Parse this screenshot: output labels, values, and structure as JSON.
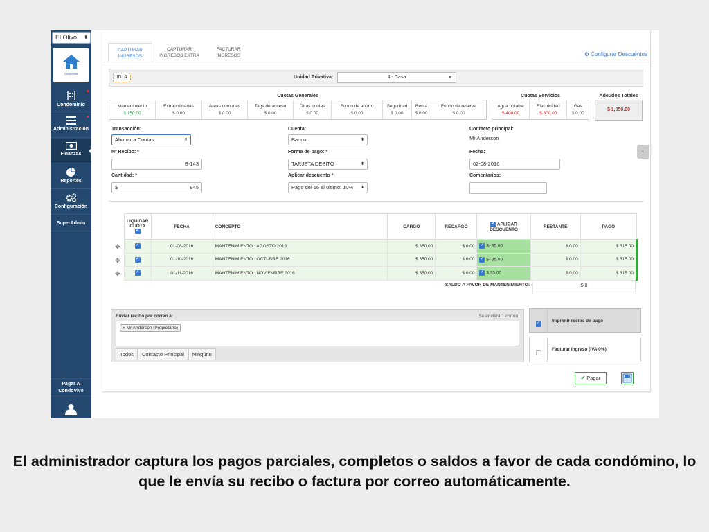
{
  "sidebar": {
    "condo_select": "El Olivo",
    "logo_text": "CondoVive",
    "items": [
      {
        "label": "Condominio",
        "icon": "building-icon"
      },
      {
        "label": "Administración",
        "icon": "list-icon"
      },
      {
        "label": "Finanzas",
        "icon": "money-icon"
      },
      {
        "label": "Reportes",
        "icon": "pie-chart-icon"
      },
      {
        "label": "Configuración",
        "icon": "gears-icon"
      },
      {
        "label": "SuperAdmin",
        "icon": ""
      }
    ],
    "pagar_a": "Pagar A",
    "pagar_a_sub": "CondoVive"
  },
  "tabs": [
    {
      "line1": "CAPTURAR",
      "line2": "INGRESOS"
    },
    {
      "line1": "CAPTURAR",
      "line2": "INGRESOS EXTRA"
    },
    {
      "line1": "FACTURAR",
      "line2": "INGRESOS"
    }
  ],
  "config_link": "Configurar Descuentos",
  "topbar": {
    "id": "ID: 4",
    "unidad_label": "Unidad Privativa:",
    "unidad_value": "4 - Casa"
  },
  "cuotas_generales": {
    "title": "Cuotas Generales",
    "items": [
      {
        "name": "Mantenimiento",
        "value": "$ 150.00"
      },
      {
        "name": "Extraordinarias",
        "value": "$ 0.00"
      },
      {
        "name": "Areas comunes",
        "value": "$ 0.00"
      },
      {
        "name": "Tags de acceso",
        "value": "$ 0.00"
      },
      {
        "name": "Otras cuotas",
        "value": "$ 0.00"
      },
      {
        "name": "Fondo de ahorro",
        "value": "$ 0.00"
      },
      {
        "name": "Seguridad",
        "value": "$ 0.00"
      },
      {
        "name": "Renta",
        "value": "$ 0.00"
      },
      {
        "name": "Fondo de reserva",
        "value": "$ 0.00"
      }
    ]
  },
  "cuotas_servicios": {
    "title": "Cuotas Servicios",
    "items": [
      {
        "name": "Agua potable",
        "value": "$ 400.00"
      },
      {
        "name": "Electricidad",
        "value": "$ 300.00"
      },
      {
        "name": "Gas",
        "value": "$ 0.00"
      }
    ]
  },
  "adeudos": {
    "title": "Adeudos Totales",
    "value": "$ 1,050.00"
  },
  "form": {
    "transaccion_label": "Transacción:",
    "transaccion_value": "Abonar a Cuotas",
    "recibo_label": "Nº Recibo: *",
    "recibo_value": "B-143",
    "cantidad_label": "Cantidad: *",
    "cantidad_prefix": "$",
    "cantidad_value": "945",
    "cuenta_label": "Cuenta:",
    "cuenta_value": "Banco",
    "forma_label": "Forma de pago: *",
    "forma_value": "TARJETA DEBITO",
    "descuento_label": "Aplicar descuento *",
    "descuento_value": "Pago del 16 al ultimo: 10%",
    "contacto_label": "Contacto principal:",
    "contacto_value": "Mr Anderson",
    "fecha_label": "Fecha:",
    "fecha_value": "02-08-2016",
    "comentarios_label": "Comentarios:",
    "comentarios_value": ""
  },
  "table": {
    "headers": {
      "liquidar": "LIQUIDAR CUOTA",
      "fecha": "FECHA",
      "concepto": "CONCEPTO",
      "cargo": "CARGO",
      "recargo": "RECARGO",
      "aplicar": "APLICAR DESCUENTO",
      "restante": "RESTANTE",
      "pago": "PAGO"
    },
    "rows": [
      {
        "fecha": "01-08-2016",
        "concepto": "MANTENIMIENTO : AGOSTO 2016",
        "cargo": "$ 350.00",
        "recargo": "$ 0.00",
        "descuento": "$- 35.00",
        "restante": "$ 0.00",
        "pago": "$ 315.00"
      },
      {
        "fecha": "01-10-2016",
        "concepto": "MANTENIMIENTO : OCTUBRE 2016",
        "cargo": "$ 350.00",
        "recargo": "$ 0.00",
        "descuento": "$- 35.00",
        "restante": "$ 0.00",
        "pago": "$ 315.00"
      },
      {
        "fecha": "01-11-2016",
        "concepto": "MANTENIMIENTO : NOVIEMBRE 2016",
        "cargo": "$ 350.00",
        "recargo": "$ 0.00",
        "descuento": "$ 35.00",
        "restante": "$ 0.00",
        "pago": "$ 315.00"
      }
    ],
    "saldo_label": "SALDO A FAVOR DE MANTENIMIENTO:",
    "saldo_value": "$ 0"
  },
  "email": {
    "label": "Enviar recibo por correo a:",
    "note": "Se enviará 1 correo.",
    "recipient": "× Mr Anderson (Propietario)",
    "buttons": [
      "Todos",
      "Contacto Principal",
      "Ningúno"
    ]
  },
  "options": {
    "imprimir": "Imprimir recibo de pago",
    "facturar": "Facturar Ingreso (IVA 0%)"
  },
  "pagar_button": "Pagar",
  "caption": "El administrador captura los pagos parciales, completos o saldos a favor de cada condómino, lo que le envía su recibo o factura por correo automáticamente.",
  "colors": {
    "sidebar": "#24486e",
    "accent": "#3a7bd5",
    "green": "#2a9a3a",
    "red": "#d22222"
  }
}
